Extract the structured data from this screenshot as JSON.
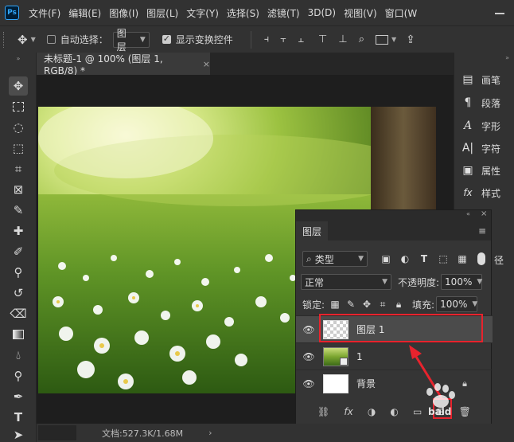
{
  "app": {
    "logo": "Ps"
  },
  "menu": [
    "文件(F)",
    "编辑(E)",
    "图像(I)",
    "图层(L)",
    "文字(Y)",
    "选择(S)",
    "滤镜(T)",
    "3D(D)",
    "视图(V)",
    "窗口(W"
  ],
  "options": {
    "auto_select_label": "自动选择：",
    "auto_select_value": "图层",
    "show_transform_label": "显示变换控件"
  },
  "document": {
    "tab_title": "未标题-1 @ 100% (图层 1, RGB/8) *",
    "close_glyph": "×",
    "status": "文档:527.3K/1.68M",
    "status_arrow": "›"
  },
  "right_panel": {
    "items": [
      {
        "icon": "brush-icon",
        "label": "画笔"
      },
      {
        "icon": "paragraph-icon",
        "label": "段落"
      },
      {
        "icon": "character-icon",
        "label": "字形"
      },
      {
        "icon": "type-icon",
        "label": "字符"
      },
      {
        "icon": "properties-icon",
        "label": "属性"
      },
      {
        "icon": "fx-icon",
        "label": "样式"
      }
    ],
    "fx_glyph": "fx",
    "extra_label": "径"
  },
  "layers_panel": {
    "tab": "图层",
    "filter_value": "类型",
    "blend_mode": "正常",
    "opacity_label": "不透明度:",
    "opacity_value": "100%",
    "lock_label": "锁定:",
    "fill_label": "填充:",
    "fill_value": "100%",
    "layers": [
      {
        "name": "图层 1",
        "selected": true,
        "type": "transparent"
      },
      {
        "name": "1",
        "selected": false,
        "type": "photo",
        "smart": true
      },
      {
        "name": "背景",
        "selected": false,
        "type": "white",
        "locked": true
      }
    ],
    "bottom_fx": "fx"
  },
  "colors": {
    "highlight": "#e8232d",
    "accent": "#31a8ff",
    "panel_bg": "#353535",
    "chrome_bg": "#323232"
  },
  "watermark": "baid"
}
